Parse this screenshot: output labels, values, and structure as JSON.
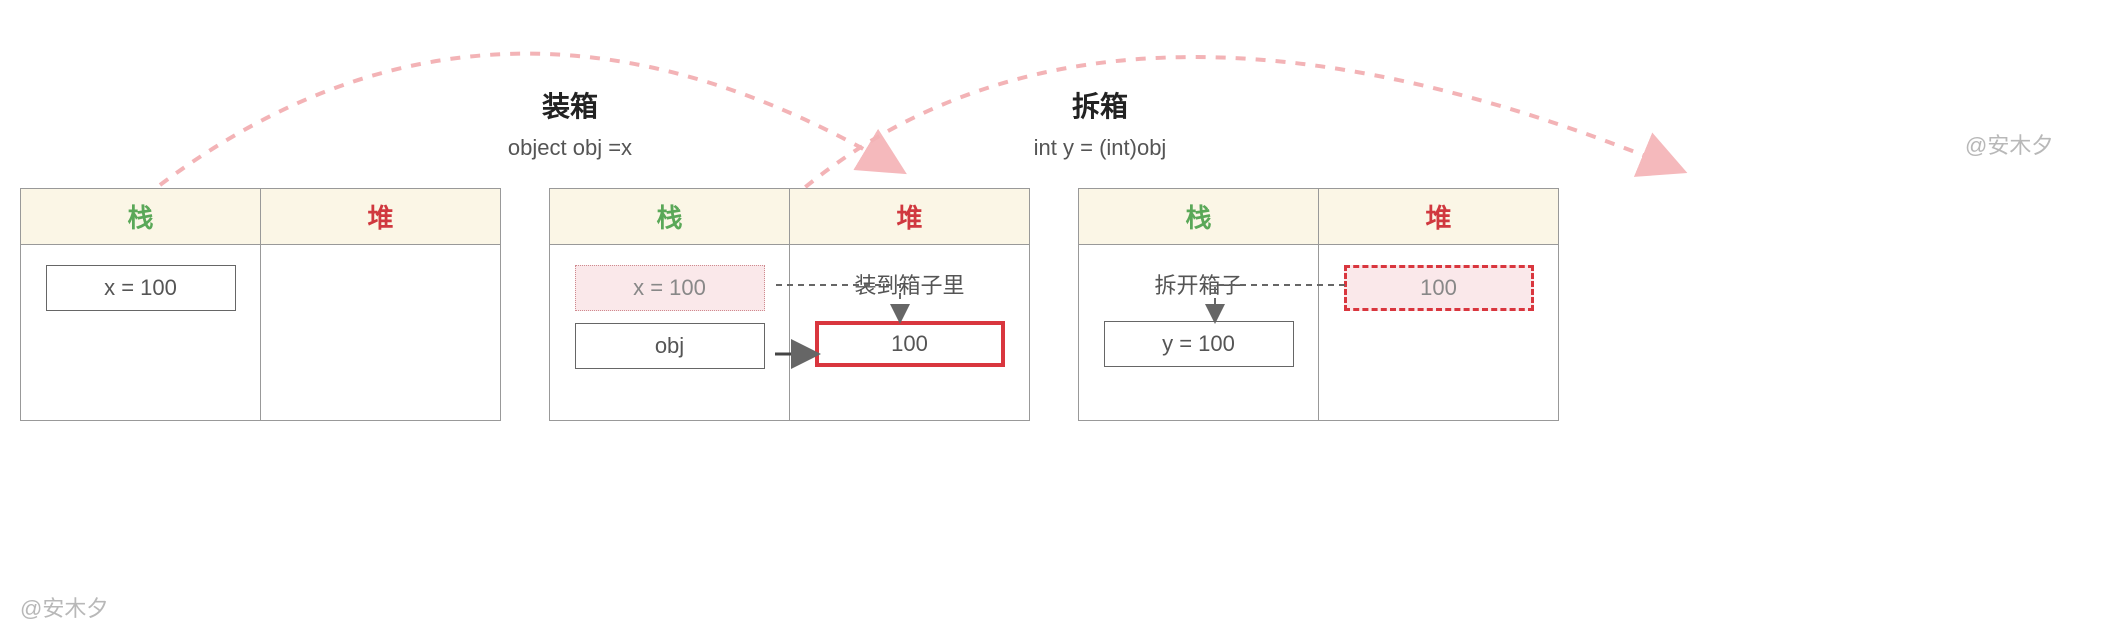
{
  "titles": {
    "boxing": {
      "cn": "装箱",
      "en": "object obj =x"
    },
    "unboxing": {
      "cn": "拆箱",
      "en": "int y = (int)obj"
    }
  },
  "headers": {
    "stack": "栈",
    "heap": "堆"
  },
  "table1": {
    "stack": {
      "x": "x = 100"
    }
  },
  "table2": {
    "stack": {
      "x": "x = 100",
      "obj": "obj"
    },
    "heap": {
      "label": "装到箱子里",
      "value": "100"
    }
  },
  "table3": {
    "stack": {
      "label": "拆开箱子",
      "y": "y = 100"
    },
    "heap": {
      "value": "100"
    }
  },
  "watermark": "@安木夕"
}
